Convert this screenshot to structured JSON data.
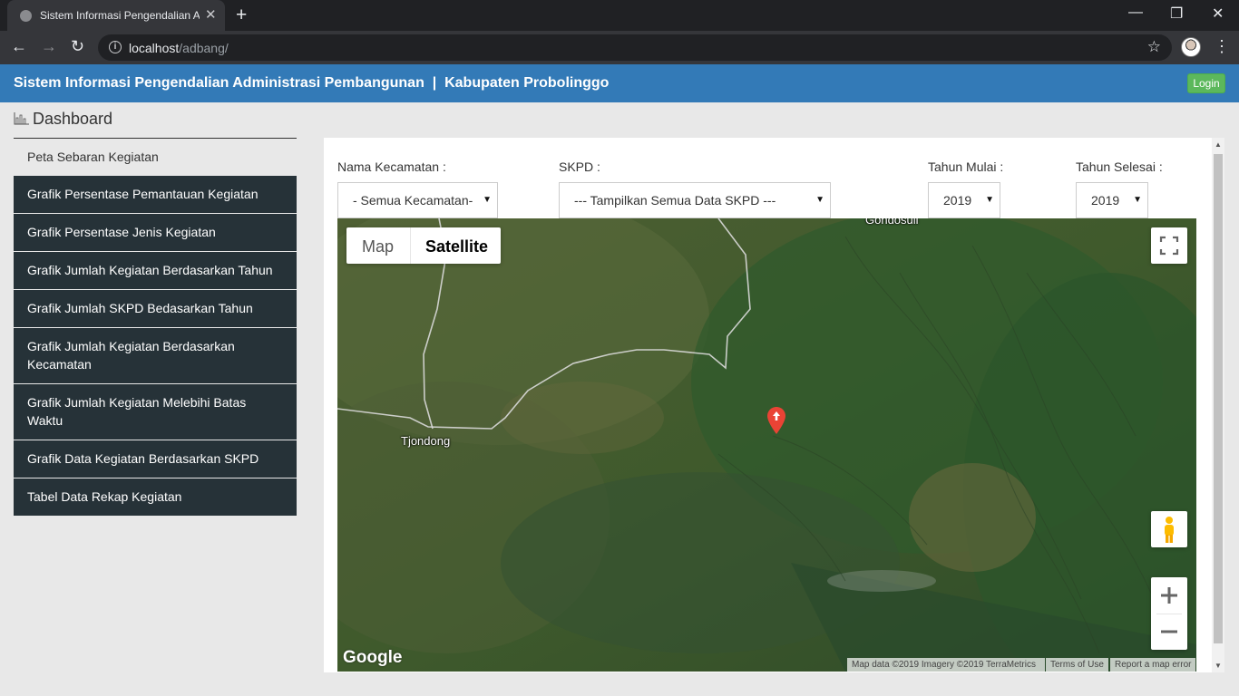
{
  "browser": {
    "tab_title": "Sistem Informasi Pengendalian A",
    "url_host": "localhost",
    "url_path": "/adbang/"
  },
  "app": {
    "brand": "Sistem Informasi Pengendalian Administrasi Pembangunan  |  Kabupaten Probolinggo",
    "login_label": "Login"
  },
  "sidebar": {
    "title": "Dashboard",
    "items": [
      {
        "label": "Peta Sebaran Kegiatan"
      },
      {
        "label": "Grafik Persentase Pemantauan Kegiatan"
      },
      {
        "label": "Grafik Persentase Jenis Kegiatan"
      },
      {
        "label": "Grafik Jumlah Kegiatan Berdasarkan Tahun"
      },
      {
        "label": "Grafik Jumlah SKPD Bedasarkan Tahun"
      },
      {
        "label": "Grafik Jumlah Kegiatan Berdasarkan Kecamatan"
      },
      {
        "label": "Grafik Jumlah Kegiatan Melebihi Batas Waktu"
      },
      {
        "label": "Grafik Data Kegiatan Berdasarkan SKPD"
      },
      {
        "label": "Tabel Data Rekap Kegiatan"
      }
    ]
  },
  "filters": {
    "kecamatan_label": "Nama Kecamatan :",
    "kecamatan_value": "- Semua Kecamatan-",
    "skpd_label": "SKPD :",
    "skpd_value": "--- Tampilkan Semua Data SKPD ---",
    "tahun_mulai_label": "Tahun Mulai :",
    "tahun_mulai_value": "2019",
    "tahun_selesai_label": "Tahun Selesai :",
    "tahun_selesai_value": "2019"
  },
  "map": {
    "type_map": "Map",
    "type_satellite": "Satellite",
    "places": [
      "Gondosuli",
      "Tjondong"
    ],
    "logo": "Google",
    "attribution": "Map data ©2019 Imagery ©2019 TerraMetrics",
    "terms": "Terms of Use",
    "report": "Report a map error"
  },
  "colors": {
    "header": "#337ab7",
    "sidebar": "#263238",
    "login": "#5cb85c",
    "marker": "#ea4335"
  }
}
